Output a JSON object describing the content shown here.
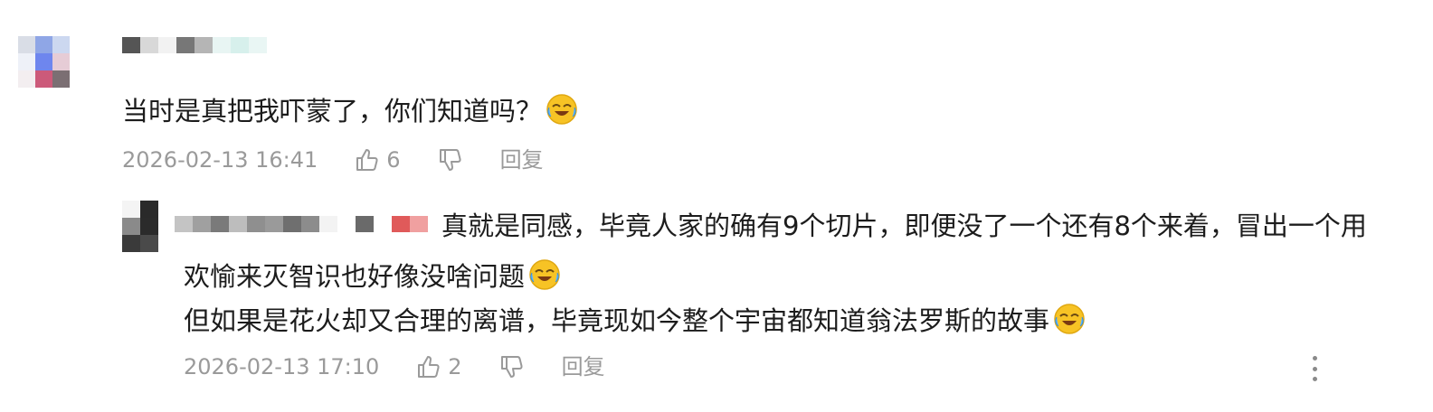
{
  "comment": {
    "text": "当时是真把我吓蒙了，你们知道吗？",
    "emoji": "laugh-cry-emoji",
    "timestamp": "2026-02-13 16:41",
    "like_count": "6",
    "reply_label": "回复"
  },
  "reply": {
    "line1": "真就是同感，毕竟人家的确有9个切片，即便没了一个还有8个来着，冒出一个用",
    "line2": "欢愉来灭智识也好像没啥问题",
    "line3": "但如果是花火却又合理的离谱，毕竟现如今整个宇宙都知道翁法罗斯的故事",
    "emoji": "laugh-cry-emoji",
    "timestamp": "2026-02-13 17:10",
    "like_count": "2",
    "reply_label": "回复"
  },
  "colors": {
    "text": "#1c1c1c",
    "meta": "#9a9a9a",
    "emoji_face": "#f7c325"
  }
}
